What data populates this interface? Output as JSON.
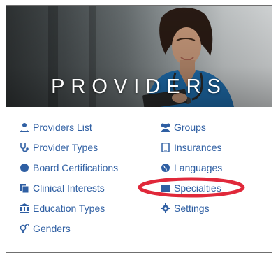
{
  "banner": {
    "title": "PROVIDERS"
  },
  "menu": {
    "left": [
      {
        "label": "Providers List",
        "icon": "providers-list-icon"
      },
      {
        "label": "Provider Types",
        "icon": "stethoscope-icon"
      },
      {
        "label": "Board Certifications",
        "icon": "certificate-icon"
      },
      {
        "label": "Clinical Interests",
        "icon": "clinical-interests-icon"
      },
      {
        "label": "Education Types",
        "icon": "university-icon"
      },
      {
        "label": "Genders",
        "icon": "genders-icon"
      }
    ],
    "right": [
      {
        "label": "Groups",
        "icon": "users-icon"
      },
      {
        "label": "Insurances",
        "icon": "insurance-card-icon"
      },
      {
        "label": "Languages",
        "icon": "globe-icon"
      },
      {
        "label": "Specialties",
        "icon": "specialties-icon"
      },
      {
        "label": "Settings",
        "icon": "gear-icon"
      }
    ]
  },
  "colors": {
    "link": "#2f5fa3",
    "highlight": "#e0283a",
    "banner_text": "#ffffff"
  }
}
